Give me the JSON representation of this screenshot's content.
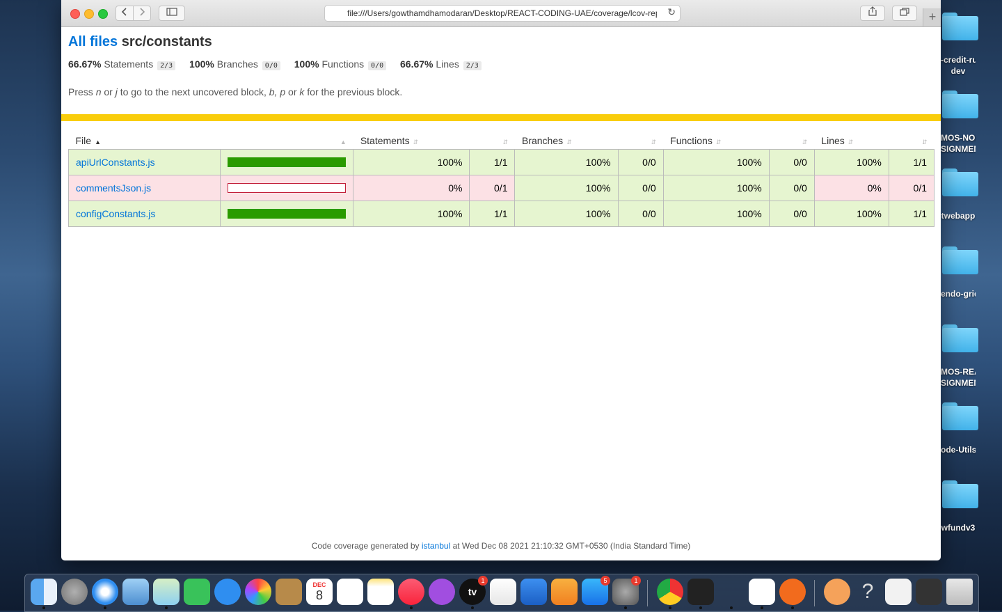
{
  "browser": {
    "url": "file:///Users/gowthamdhamodaran/Desktop/REACT-CODING-UAE/coverage/lcov-report/src/constants/index.html",
    "new_tab_symbol": "+"
  },
  "report": {
    "all_files_link": "All files",
    "path": "src/constants",
    "summary": [
      {
        "pct": "66.67%",
        "label": "Statements",
        "fraction": "2/3"
      },
      {
        "pct": "100%",
        "label": "Branches",
        "fraction": "0/0"
      },
      {
        "pct": "100%",
        "label": "Functions",
        "fraction": "0/0"
      },
      {
        "pct": "66.67%",
        "label": "Lines",
        "fraction": "2/3"
      }
    ],
    "hint": {
      "press": "Press",
      "key1": "n",
      "or1": "or",
      "key2": "j",
      "mid": "to go to the next uncovered block,",
      "key3": "b,",
      "key4": "p",
      "or2": "or",
      "key5": "k",
      "end": "for the previous block."
    },
    "columns": {
      "file": "File",
      "statements": "Statements",
      "branches": "Branches",
      "functions": "Functions",
      "lines": "Lines"
    },
    "rows": [
      {
        "file": "apiUrlConstants.js",
        "level": "high",
        "coverage": 1.0,
        "statements_pct": "100%",
        "statements": "1/1",
        "branches_pct": "100%",
        "branches": "0/0",
        "functions_pct": "100%",
        "functions": "0/0",
        "lines_pct": "100%",
        "lines": "1/1"
      },
      {
        "file": "commentsJson.js",
        "level": "low",
        "coverage": 0.0,
        "statements_pct": "0%",
        "statements": "0/1",
        "branches_pct": "100%",
        "branches": "0/0",
        "functions_pct": "100%",
        "functions": "0/0",
        "lines_pct": "0%",
        "lines": "0/1"
      },
      {
        "file": "configConstants.js",
        "level": "high",
        "coverage": 1.0,
        "statements_pct": "100%",
        "statements": "1/1",
        "branches_pct": "100%",
        "branches": "0/0",
        "functions_pct": "100%",
        "functions": "0/0",
        "lines_pct": "100%",
        "lines": "1/1"
      }
    ],
    "footer": {
      "prefix": "Code coverage generated by",
      "link": "istanbul",
      "suffix": "at Wed Dec 08 2021 21:10:32 GMT+0530 (India Standard Time)"
    }
  },
  "desktop": {
    "folders": [
      "-credit-rule-\ndev",
      "MOS-NODE-\nSIGNMENT",
      "twebapp",
      "endo-grid",
      "MOS-REACT-\nSIGNMENT",
      "ode-Utils",
      "wfundv3"
    ]
  },
  "dock": {
    "calendar_month": "DEC",
    "calendar_day": "8",
    "tv_label": "tv",
    "tv_badge": "1",
    "appstore_badge": "5",
    "settings_badge": "1"
  },
  "colors": {
    "accent_link": "#0074d9",
    "high_bg": "#e6f5d0",
    "low_bg": "#fce1e5",
    "bar_green": "#2a9b00",
    "bar_red": "#c21f39",
    "status_yellow": "#f9cd0b"
  }
}
